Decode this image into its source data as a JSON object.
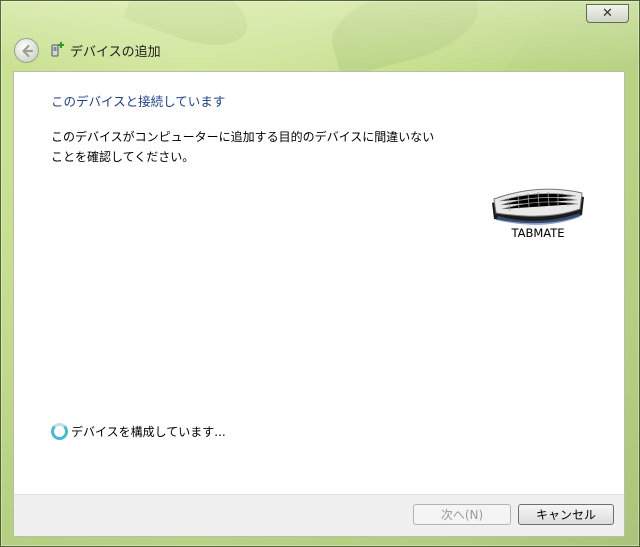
{
  "window": {
    "close_symbol": "✕"
  },
  "header": {
    "title": "デバイスの追加",
    "back_icon": "back-arrow-icon",
    "title_icon": "add-device-icon"
  },
  "content": {
    "heading": "このデバイスと接続しています",
    "description_line1": "このデバイスがコンピューターに追加する目的のデバイスに間違いない",
    "description_line2": "ことを確認してください。",
    "device": {
      "name": "TABMATE",
      "icon": "keyboard-icon"
    },
    "status": "デバイスを構成しています..."
  },
  "footer": {
    "next_label": "次へ(N)",
    "cancel_label": "キャンセル"
  },
  "colors": {
    "heading": "#1e3f8a",
    "spinner": "#49b8d4",
    "disabled_text": "#9a9a9a"
  }
}
